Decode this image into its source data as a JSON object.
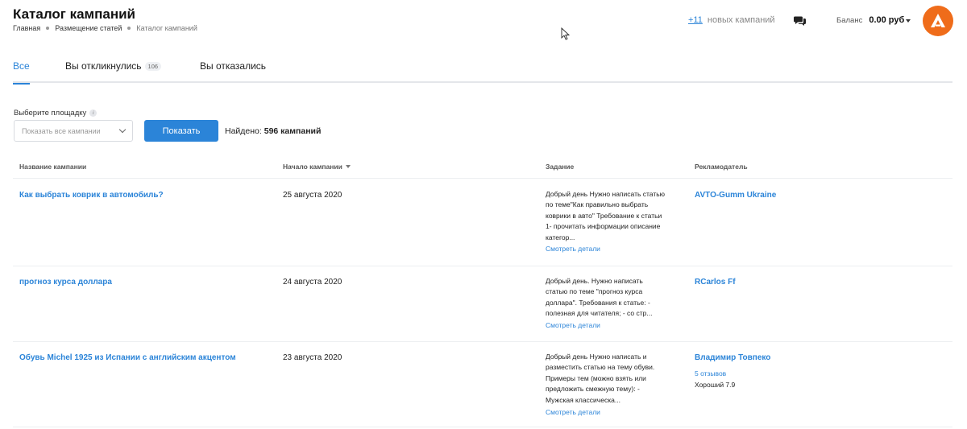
{
  "header": {
    "title": "Каталог кампаний",
    "breadcrumb": [
      "Главная",
      "Размещение статей",
      "Каталог кампаний"
    ],
    "new_campaigns": {
      "count": "+11",
      "label": "новых кампаний"
    },
    "balance": {
      "label": "Баланс",
      "amount": "0.00 руб"
    },
    "icons": {
      "chat": "chat-bubbles-icon",
      "avatar": "logo-a-icon",
      "cursor": "mouse-pointer-icon"
    },
    "colors": {
      "accent": "#2b84d8",
      "avatar": "#ef6c1a"
    }
  },
  "tabs": [
    {
      "label": "Все",
      "active": true
    },
    {
      "label": "Вы откликнулись",
      "badge": "106"
    },
    {
      "label": "Вы отказались"
    }
  ],
  "filter": {
    "label": "Выберите площадку",
    "select_placeholder": "Показать все кампании",
    "show_button": "Показать",
    "found_prefix": "Найдено:",
    "found_value": "596 кампаний"
  },
  "table": {
    "columns": [
      "Название кампании",
      "Начало кампании",
      "Задание",
      "Рекламодатель"
    ],
    "rows": [
      {
        "name": "Как выбрать коврик в автомобиль?",
        "date": "25 августа 2020",
        "task": "Добрый день Нужно написать статью по теме\"Как правильно выбрать коврики в авто\" Требование к статьи 1- прочитать информации описание категор...",
        "more": "Смотреть детали",
        "advertiser": "AVTO-Gumm Ukraine"
      },
      {
        "name": "прогноз курса доллара",
        "date": "24 августа 2020",
        "task": "Добрый день. Нужно написать статью по теме \"прогноз курса доллара\". Требования к статье: - полезная для читателя; - со стр...",
        "more": "Смотреть детали",
        "advertiser": "RCarlos Ff"
      },
      {
        "name": "Обувь Michel 1925 из Испании с английским акцентом",
        "date": "23 августа 2020",
        "task": "Добрый день Нужно написать и разместить статью на тему обуви. Примеры тем (можно взять или предложить смежную тему): - Мужская классическа...",
        "more": "Смотреть детали",
        "advertiser": "Владимир Товпеко",
        "reviews": "5 отзывов",
        "rating": "Хороший 7.9"
      }
    ]
  }
}
